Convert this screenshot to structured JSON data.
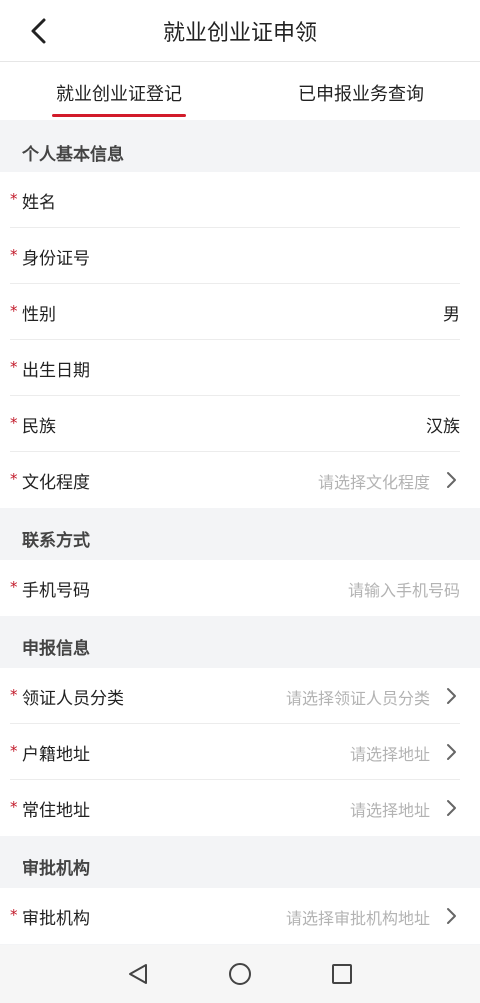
{
  "header": {
    "title": "就业创业证申领"
  },
  "tabs": [
    {
      "label": "就业创业证登记",
      "active": true
    },
    {
      "label": "已申报业务查询",
      "active": false
    }
  ],
  "sections": {
    "personal": {
      "title": "个人基本信息",
      "fields": {
        "name": {
          "label": "姓名",
          "value": ""
        },
        "id_number": {
          "label": "身份证号",
          "value": ""
        },
        "gender": {
          "label": "性别",
          "value": "男"
        },
        "birth_date": {
          "label": "出生日期",
          "value": ""
        },
        "ethnicity": {
          "label": "民族",
          "value": "汉族"
        },
        "education": {
          "label": "文化程度",
          "placeholder": "请选择文化程度"
        }
      }
    },
    "contact": {
      "title": "联系方式",
      "fields": {
        "phone": {
          "label": "手机号码",
          "placeholder": "请输入手机号码"
        }
      }
    },
    "application": {
      "title": "申报信息",
      "fields": {
        "category": {
          "label": "领证人员分类",
          "placeholder": "请选择领证人员分类"
        },
        "household_address": {
          "label": "户籍地址",
          "placeholder": "请选择地址"
        },
        "residence_address": {
          "label": "常住地址",
          "placeholder": "请选择地址"
        }
      }
    },
    "authority": {
      "title": "审批机构",
      "fields": {
        "authority": {
          "label": "审批机构",
          "placeholder": "请选择审批机构地址"
        }
      }
    }
  },
  "required_mark": "*",
  "colors": {
    "accent": "#d21b2a",
    "placeholder": "#b3b3b3",
    "required": "#c21a2a"
  },
  "icons": {
    "back": "chevron-left-icon",
    "row_arrow": "chevron-right-icon",
    "nav": [
      "nav-back-icon",
      "nav-home-icon",
      "nav-recents-icon"
    ]
  }
}
